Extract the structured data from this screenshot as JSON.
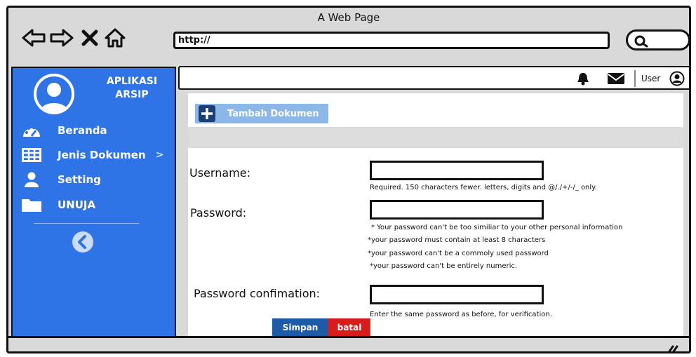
{
  "window": {
    "title": "A Web Page"
  },
  "browser": {
    "url": "http://",
    "nav_icons": [
      "back-arrow-icon",
      "forward-arrow-icon",
      "close-icon",
      "home-icon"
    ],
    "search_icon": "search-icon"
  },
  "sidebar": {
    "app_name": "APLIKASI ARSIP",
    "items": [
      {
        "label": "Beranda",
        "icon": "dashboard-icon"
      },
      {
        "label": "Jenis Dokumen",
        "icon": "table-icon",
        "chevron": ">"
      },
      {
        "label": "Setting",
        "icon": "user-icon"
      },
      {
        "label": "UNUJA",
        "icon": "folder-icon"
      }
    ],
    "collapse_icon": "chevron-left-icon"
  },
  "topbar": {
    "user_label": "User",
    "icons": [
      "bell-icon",
      "mail-icon",
      "user-avatar-icon"
    ]
  },
  "main": {
    "add_button_label": "Tambah Dokumen",
    "form": {
      "username_label": "Username:",
      "username_value": "",
      "username_hint": "Required. 150 characters fewer. letters, digits and @/./+/-/_ only.",
      "password_label": "Password:",
      "password_value": "",
      "password_hints": [
        "* Your password can't be too similiar to your other personal information",
        "*your password must contain at least 8 characters",
        "*your password can't be a commoly used password",
        "*your password can't be entirely numeric."
      ],
      "confirm_label": "Password confimation:",
      "confirm_value": "",
      "confirm_hint": "Enter the same password as before, for verification."
    },
    "save_label": "Simpan",
    "cancel_label": "batal"
  },
  "colors": {
    "sidebar_bg": "#2f74e6",
    "add_button_bg": "#8bb8e8",
    "save_button_bg": "#1d5aa8",
    "cancel_button_bg": "#d81b1b"
  }
}
